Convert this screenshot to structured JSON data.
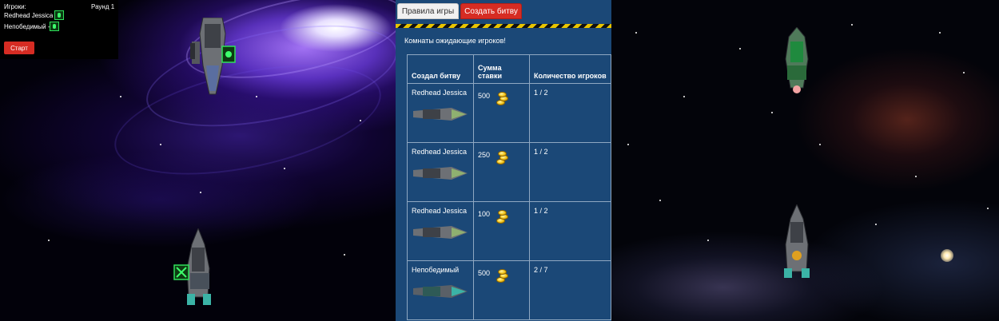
{
  "hud": {
    "players_label": "Игроки:",
    "round_label": "Раунд 1",
    "players": [
      "Redhead Jessica -",
      "Непобедимый -"
    ],
    "start_label": "Старт"
  },
  "lobby": {
    "rules_button": "Правила игры",
    "create_button": "Создать битву",
    "title": "Комнаты ожидающие игроков!",
    "headers": [
      "Создал битву",
      "Сумма ставки",
      "Количество игроков"
    ],
    "rooms": [
      {
        "creator": "Redhead Jessica",
        "stake": "500",
        "players": "1 / 2"
      },
      {
        "creator": "Redhead Jessica",
        "stake": "250",
        "players": "1 / 2"
      },
      {
        "creator": "Redhead Jessica",
        "stake": "100",
        "players": "1 / 2"
      },
      {
        "creator": "Непобедимый",
        "stake": "500",
        "players": "2 / 7"
      }
    ]
  },
  "colors": {
    "accent_red": "#d62c23",
    "lobby_bg": "#1b4877",
    "player_marker": "#2fe05a"
  }
}
